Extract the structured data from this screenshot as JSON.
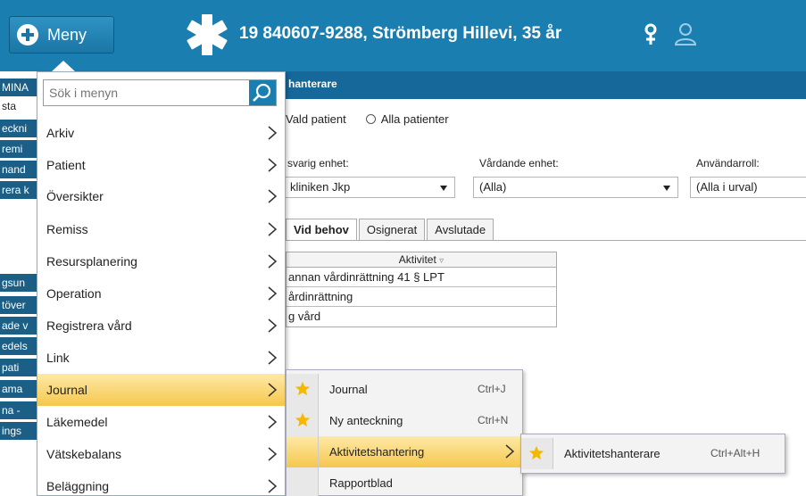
{
  "header": {
    "menu_label": "Meny",
    "patient_info": "19 840607-9288,  Strömberg Hillevi,  35 år"
  },
  "left_strip": {
    "items": [
      "MINA",
      "sta",
      "eckni",
      "remi",
      "nand",
      "rera k",
      "gsun",
      "töver",
      "ade v",
      "edels",
      "pati",
      "ama",
      "na -",
      "ings"
    ]
  },
  "content": {
    "title": "hanterare",
    "radio_selected": "Vald patient",
    "radio_other": "Alla patienter",
    "labels": {
      "ansvarig": "svarig enhet:",
      "vardande": "Vårdande enhet:",
      "anvandarroll": "Användarroll:"
    },
    "selects": {
      "ansvarig": "kliniken Jkp",
      "vardande": "(Alla)",
      "anvandarroll": "(Alla i urval)"
    },
    "tabs": [
      "Vid behov",
      "Osignerat",
      "Avslutade"
    ],
    "grid_header": "Aktivitet",
    "grid_rows": [
      "annan vårdinrättning 41 § LPT",
      "årdinrättning",
      "g vård"
    ]
  },
  "menu": {
    "search_placeholder": "Sök i menyn",
    "items": [
      {
        "label": "Arkiv"
      },
      {
        "label": "Patient"
      },
      {
        "label": "Översikter"
      },
      {
        "label": "Remiss"
      },
      {
        "label": "Resursplanering"
      },
      {
        "label": "Operation"
      },
      {
        "label": "Registrera vård"
      },
      {
        "label": "Link"
      },
      {
        "label": "Journal"
      },
      {
        "label": "Läkemedel"
      },
      {
        "label": "Vätskebalans"
      },
      {
        "label": "Beläggning"
      }
    ]
  },
  "submenu_journal": {
    "items": [
      {
        "label": "Journal",
        "shortcut": "Ctrl+J"
      },
      {
        "label": "Ny anteckning",
        "shortcut": "Ctrl+N"
      },
      {
        "label": "Aktivitetshantering",
        "shortcut": ""
      },
      {
        "label": "Rapportblad",
        "shortcut": ""
      }
    ]
  },
  "submenu_aktivitet": {
    "items": [
      {
        "label": "Aktivitetshanterare",
        "shortcut": "Ctrl+Alt+H"
      }
    ]
  },
  "colors": {
    "header_bg": "#1a7fb0",
    "highlight": "#f6c74d",
    "star": "#f5b800"
  }
}
